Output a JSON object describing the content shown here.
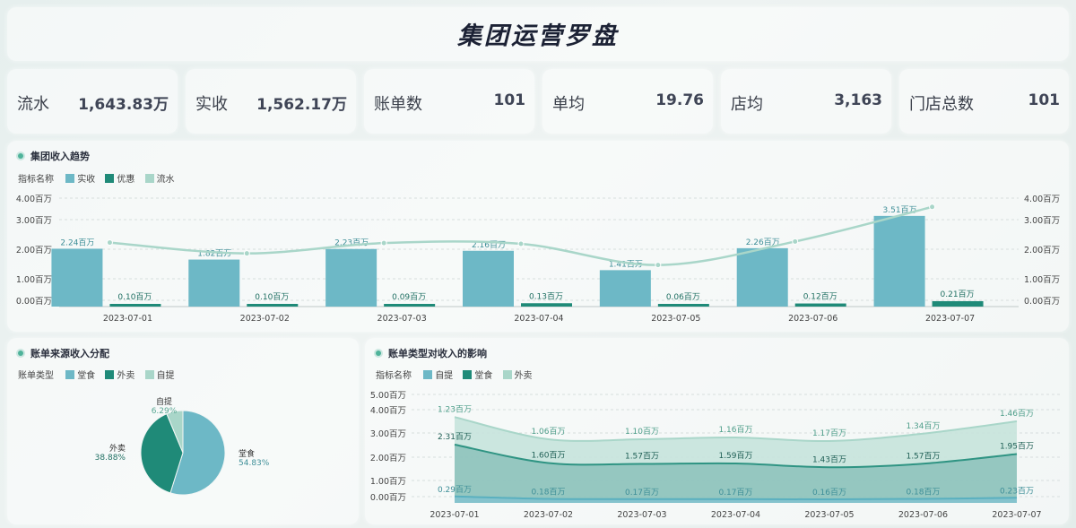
{
  "header": {
    "title": "集团运营罗盘"
  },
  "kpis": [
    {
      "label": "流水",
      "value": "1,643.83万"
    },
    {
      "label": "实收",
      "value": "1,562.17万"
    },
    {
      "label": "账单数",
      "value": "101"
    },
    {
      "label": "单均",
      "value": "19.76"
    },
    {
      "label": "店均",
      "value": "3,163"
    },
    {
      "label": "门店总数",
      "value": "101"
    }
  ],
  "trend": {
    "title": "集团收入趋势",
    "legend_title": "指标名称",
    "legend": [
      {
        "name": "实收",
        "color": "#6db8c6"
      },
      {
        "name": "优惠",
        "color": "#1f8a78"
      },
      {
        "name": "流水",
        "color": "#a9d6c9"
      }
    ]
  },
  "pie": {
    "title": "账单来源收入分配",
    "legend_title": "账单类型",
    "legend": [
      {
        "name": "堂食",
        "color": "#6db8c6"
      },
      {
        "name": "外卖",
        "color": "#1f8a78"
      },
      {
        "name": "自提",
        "color": "#a9d6c9"
      }
    ]
  },
  "area": {
    "title": "账单类型对收入的影响",
    "legend_title": "指标名称",
    "legend": [
      {
        "name": "自提",
        "color": "#6db8c6"
      },
      {
        "name": "堂食",
        "color": "#1f8a78"
      },
      {
        "name": "外卖",
        "color": "#a9d6c9"
      }
    ]
  },
  "chart_data": [
    {
      "type": "bar",
      "title": "集团收入趋势",
      "categories": [
        "2023-07-01",
        "2023-07-02",
        "2023-07-03",
        "2023-07-04",
        "2023-07-05",
        "2023-07-06",
        "2023-07-07"
      ],
      "series": [
        {
          "name": "实收",
          "type": "bar",
          "values": [
            2.24,
            1.82,
            2.23,
            2.16,
            1.41,
            2.26,
            3.51
          ],
          "labels": [
            "2.24百万",
            "1.82百万",
            "2.23百万",
            "2.16百万",
            "1.41百万",
            "2.26百万",
            "3.51百万"
          ]
        },
        {
          "name": "优惠",
          "type": "bar",
          "values": [
            0.1,
            0.1,
            0.09,
            0.13,
            0.06,
            0.12,
            0.21
          ],
          "labels": [
            "0.10百万",
            "0.10百万",
            "0.09百万",
            "0.13百万",
            "0.06百万",
            "0.12百万",
            "0.21百万"
          ]
        },
        {
          "name": "流水",
          "type": "line",
          "values": [
            2.34,
            1.92,
            2.32,
            2.29,
            1.47,
            2.38,
            3.72
          ]
        }
      ],
      "y_ticks": [
        "4.00百万",
        "3.00百万",
        "2.00百万",
        "1.00百万",
        "0.00百万"
      ],
      "ylim": [
        0,
        4
      ],
      "legend": "top-left"
    },
    {
      "type": "pie",
      "title": "账单来源收入分配",
      "slices": [
        {
          "name": "堂食",
          "value": 54.83,
          "label": "54.83%"
        },
        {
          "name": "外卖",
          "value": 38.88,
          "label": "38.88%"
        },
        {
          "name": "自提",
          "value": 6.29,
          "label": "6.29%"
        }
      ],
      "legend": "top-left"
    },
    {
      "type": "area",
      "title": "账单类型对收入的影响",
      "categories": [
        "2023-07-01",
        "2023-07-02",
        "2023-07-03",
        "2023-07-04",
        "2023-07-05",
        "2023-07-06",
        "2023-07-07"
      ],
      "series": [
        {
          "name": "自提",
          "values": [
            0.29,
            0.18,
            0.17,
            0.17,
            0.16,
            0.18,
            0.23
          ],
          "labels": [
            "0.29百万",
            "0.18百万",
            "0.17百万",
            "0.17百万",
            "0.16百万",
            "0.18百万",
            "0.23百万"
          ]
        },
        {
          "name": "堂食",
          "values": [
            2.31,
            1.6,
            1.57,
            1.59,
            1.43,
            1.57,
            1.95
          ],
          "labels": [
            "2.31百万",
            "1.60百万",
            "1.57百万",
            "1.59百万",
            "1.43百万",
            "1.57百万",
            "1.95百万"
          ]
        },
        {
          "name": "外卖",
          "values": [
            1.23,
            1.06,
            1.1,
            1.16,
            1.17,
            1.34,
            1.46
          ],
          "labels": [
            "1.23百万",
            "1.06百万",
            "1.10百万",
            "1.16百万",
            "1.17百万",
            "1.34百万",
            "1.46百万"
          ]
        }
      ],
      "stacked": true,
      "y_ticks": [
        "5.00百万",
        "4.00百万",
        "3.00百万",
        "2.00百万",
        "1.00百万",
        "0.00百万"
      ],
      "ylim": [
        0,
        5
      ],
      "legend": "top-left"
    }
  ]
}
